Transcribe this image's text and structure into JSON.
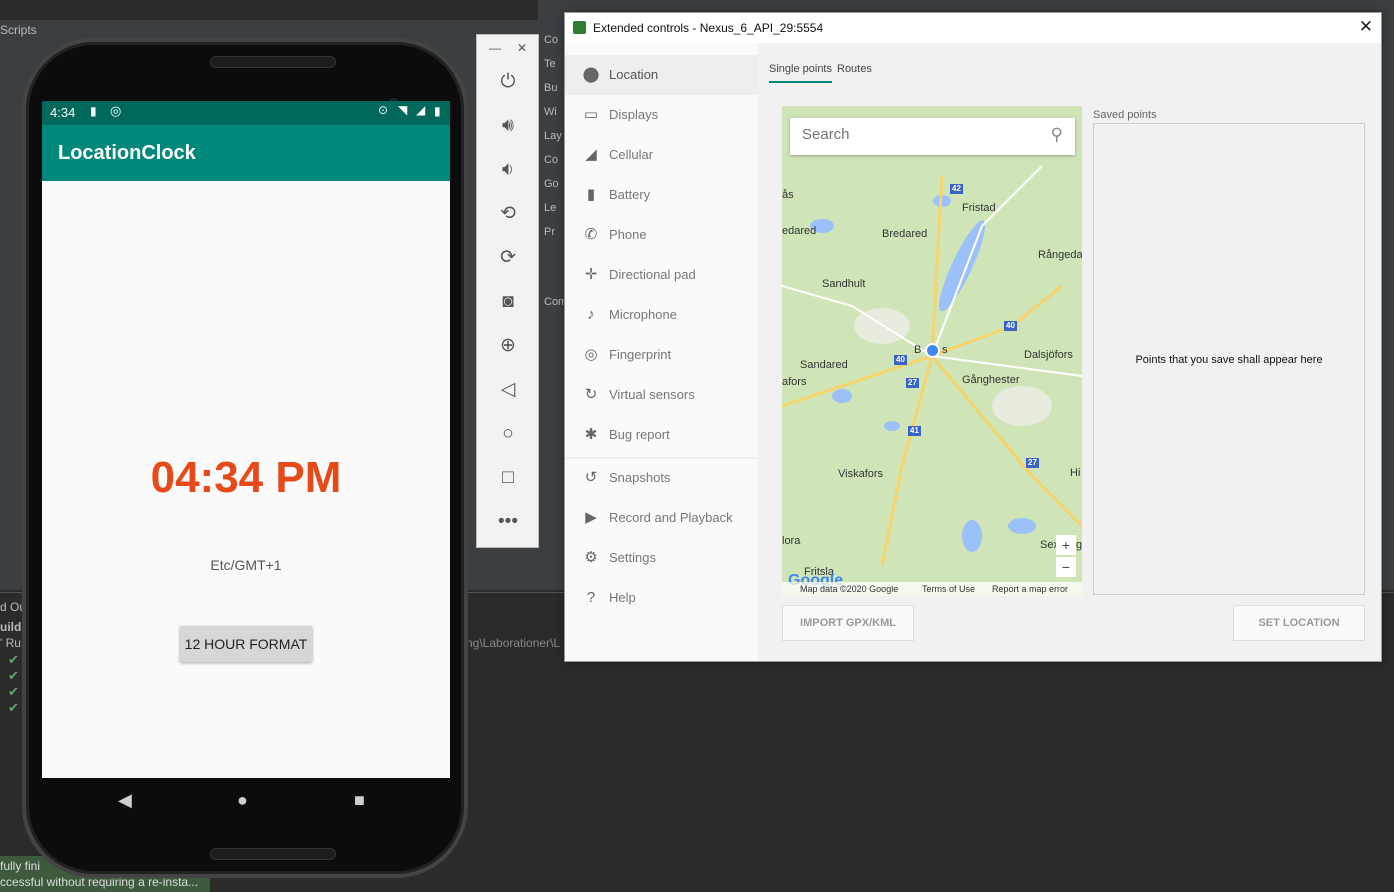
{
  "ide": {
    "scripts_label": "Scripts",
    "panel_items": [
      "Co",
      "Te",
      "Bu",
      "Wi",
      "Lay",
      "Co",
      "Go",
      "Le",
      "Pr"
    ],
    "bottom_panel_label": "Com",
    "build_labels": [
      "d Ou",
      "uild:",
      "' Ru"
    ],
    "path_text": "ng\\Laborationer\\L",
    "status_lines": [
      "fully fini",
      "ccessful without requiring a re-insta..."
    ]
  },
  "phone": {
    "status_time": "4:34",
    "app_title": "LocationClock",
    "clock_text": "04:34 PM",
    "timezone_text": "Etc/GMT+1",
    "format_button": "12 HOUR FORMAT"
  },
  "ext_controls": {
    "title": "Extended controls - Nexus_6_API_29:5554",
    "nav": [
      {
        "label": "Location",
        "icon": "location-pin-icon"
      },
      {
        "label": "Displays",
        "icon": "display-icon"
      },
      {
        "label": "Cellular",
        "icon": "signal-icon"
      },
      {
        "label": "Battery",
        "icon": "battery-icon"
      },
      {
        "label": "Phone",
        "icon": "phone-icon"
      },
      {
        "label": "Directional pad",
        "icon": "dpad-icon"
      },
      {
        "label": "Microphone",
        "icon": "microphone-icon"
      },
      {
        "label": "Fingerprint",
        "icon": "fingerprint-icon"
      },
      {
        "label": "Virtual sensors",
        "icon": "sensors-icon"
      },
      {
        "label": "Bug report",
        "icon": "bug-icon"
      },
      {
        "label": "Snapshots",
        "icon": "history-icon"
      },
      {
        "label": "Record and Playback",
        "icon": "video-camera-icon"
      },
      {
        "label": "Settings",
        "icon": "gear-icon"
      },
      {
        "label": "Help",
        "icon": "help-icon"
      }
    ],
    "tabs": [
      "Single points",
      "Routes"
    ],
    "search_placeholder": "Search",
    "map_labels": [
      "ås",
      "Fristad",
      "edared",
      "Bredared",
      "Rångeda",
      "Sandhult",
      "B",
      "s",
      "Sandared",
      "Dalsjöfors",
      "afors",
      "Gånghester",
      "Viskafors",
      "Hi",
      "lora",
      "Sex",
      "g",
      "Fritsla"
    ],
    "road_numbers": [
      "42",
      "40",
      "40",
      "27",
      "41",
      "27"
    ],
    "attribution": {
      "map_data": "Map data ©2020 Google",
      "terms": "Terms of Use",
      "report": "Report a map error"
    },
    "google_logo": "Google",
    "saved_points_label": "Saved points",
    "saved_points_empty": "Points that you save shall appear here",
    "import_button": "IMPORT GPX/KML",
    "set_location_button": "SET LOCATION"
  }
}
